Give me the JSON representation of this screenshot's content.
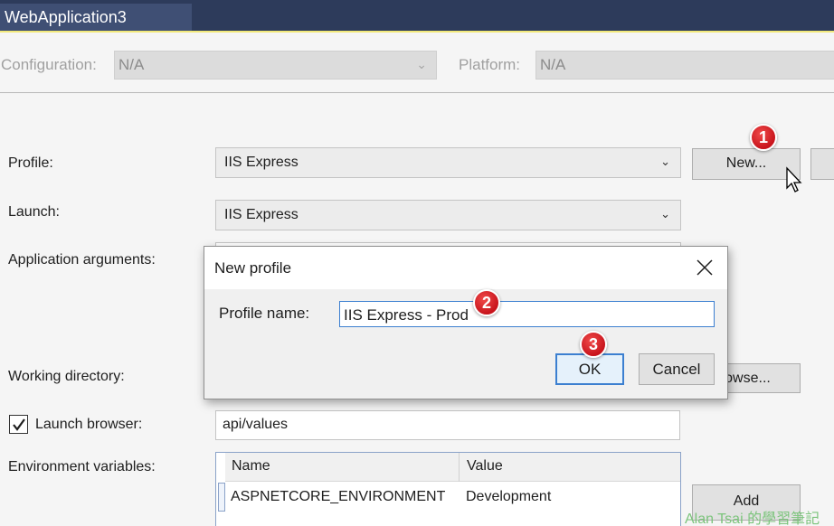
{
  "tab": {
    "title": "WebApplication3"
  },
  "config": {
    "configuration_label": "Configuration:",
    "configuration_value": "N/A",
    "platform_label": "Platform:",
    "platform_value": "N/A"
  },
  "form": {
    "profile_label": "Profile:",
    "profile_value": "IIS Express",
    "new_button": "New...",
    "launch_label": "Launch:",
    "launch_value": "IIS Express",
    "app_args_label": "Application arguments:",
    "working_dir_label": "Working directory:",
    "browse_button": "Browse...",
    "browse_visible": "rowse...",
    "launch_browser_label": "Launch browser:",
    "launch_browser_checked": true,
    "launch_browser_url": "api/values",
    "env_vars_label": "Environment variables:",
    "env_columns": [
      "Name",
      "Value"
    ],
    "env_rows": [
      {
        "name": "ASPNETCORE_ENVIRONMENT",
        "value": "Development"
      }
    ],
    "add_button": "Add"
  },
  "dialog": {
    "title": "New profile",
    "profile_name_label": "Profile name:",
    "profile_name_value": "IIS Express - Prod",
    "ok_button": "OK",
    "cancel_button": "Cancel"
  },
  "markers": [
    "1",
    "2",
    "3"
  ],
  "watermark": "Alan Tsai 的學習筆記",
  "colors": {
    "titlebar": "#2d3b5b",
    "tab_active": "#3f4f74",
    "accent": "#f1e87a",
    "focus_border": "#3c7fd0",
    "marker": "#d81e24"
  }
}
